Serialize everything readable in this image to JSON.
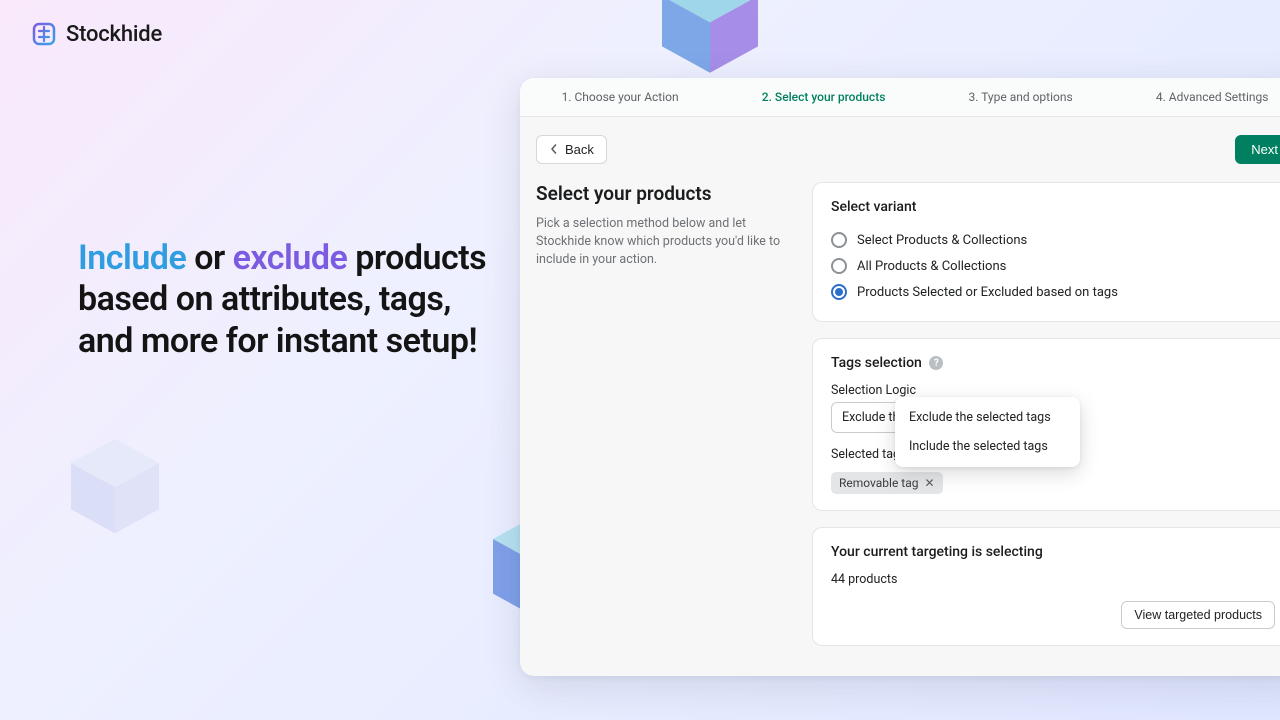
{
  "brand": {
    "name": "Stockhide"
  },
  "headline": {
    "part1": "Include",
    "part2": " or ",
    "part3": "exclude",
    "part4": " products based on attributes, tags, and more for instant setup!"
  },
  "wizard": {
    "steps": [
      {
        "label": "1. Choose your Action"
      },
      {
        "label": "2. Select your products"
      },
      {
        "label": "3. Type and options"
      },
      {
        "label": "4. Advanced Settings"
      }
    ],
    "active_index": 1,
    "back_label": "Back",
    "next_label": "Next"
  },
  "page": {
    "title": "Select your products",
    "desc": "Pick a selection method below and let Stockhide know which products you'd like to include in your action."
  },
  "variant_card": {
    "title": "Select variant",
    "options": [
      "Select Products & Collections",
      "All Products & Collections",
      "Products Selected or Excluded based on tags"
    ],
    "selected_index": 2
  },
  "tags_card": {
    "title": "Tags selection",
    "logic_label": "Selection Logic",
    "logic_value": "Exclude the selected tags",
    "logic_options": [
      "Exclude the selected tags",
      "Include the selected tags"
    ],
    "selected_label": "Selected tags",
    "selected_tag": "Removable tag"
  },
  "target_card": {
    "title": "Your current targeting is selecting",
    "count_text": "44 products",
    "view_button": "View targeted products"
  }
}
